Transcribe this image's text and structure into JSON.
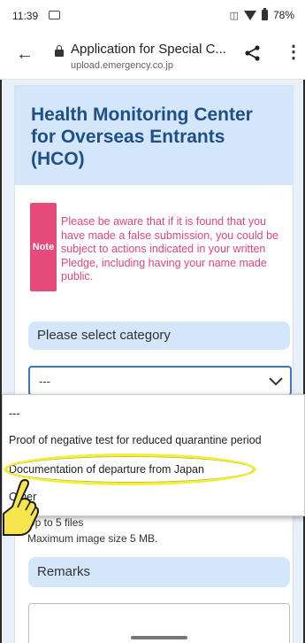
{
  "status_bar": {
    "time": "11:39",
    "battery": "78%"
  },
  "browser": {
    "title": "Application for Special C...",
    "url": "upload.emergency.co.jp"
  },
  "page": {
    "header_title": "Health Monitoring Center for Overseas Entrants (HCO)",
    "note_tag": "Note",
    "note_text": "Please be aware that if it is found that you have made a false submission, you could be subject to actions indicated in your written Pledge, including having your name made public.",
    "category_label": "Please select category",
    "select_value": "---",
    "files_limit": "Up to 5 files",
    "max_image_size": "Maximum image size 5 MB.",
    "remarks_label": "Remarks"
  },
  "dropdown": {
    "options": [
      "---",
      "Proof of negative test for reduced quarantine period",
      "Documentation of departure from Japan",
      "Other"
    ]
  },
  "colors": {
    "header_bg": "#d4e6fa",
    "header_text": "#1f4f86",
    "note": "#e54b7b",
    "highlight": "#f4ef3d",
    "select_border": "#3a76c4"
  }
}
